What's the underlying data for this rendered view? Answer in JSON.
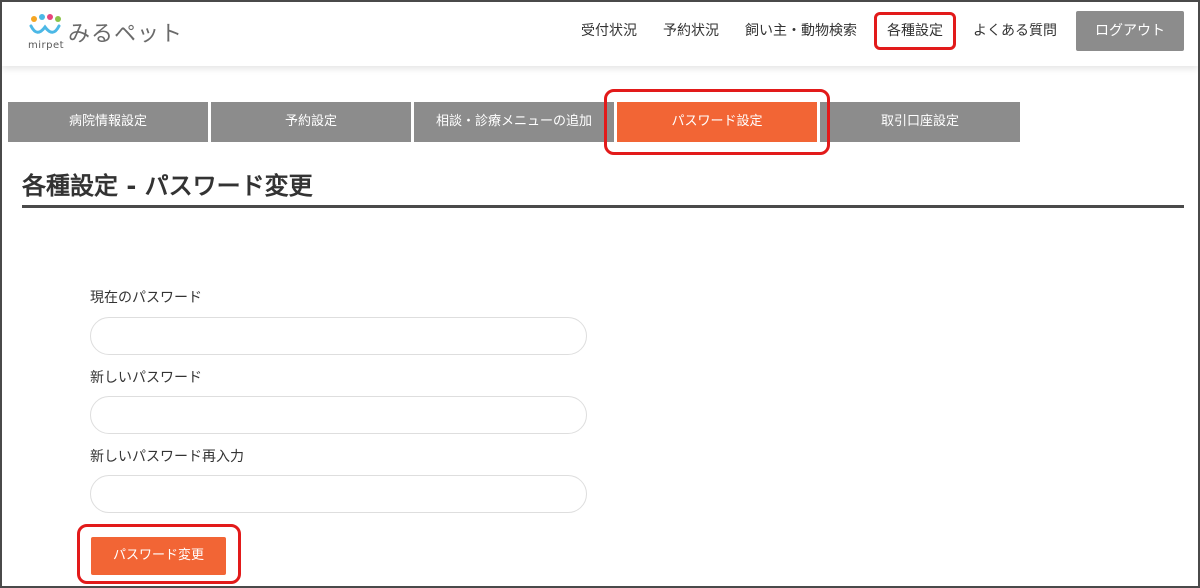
{
  "header": {
    "logo_text": "みるペット",
    "logo_sub": "mirpet",
    "nav": [
      {
        "label": "受付状況"
      },
      {
        "label": "予約状況"
      },
      {
        "label": "飼い主・動物検索"
      },
      {
        "label": "各種設定"
      },
      {
        "label": "よくある質問"
      }
    ],
    "logout_label": "ログアウト"
  },
  "tabs": [
    {
      "label": "病院情報設定"
    },
    {
      "label": "予約設定"
    },
    {
      "label": "相談・診療メニューの追加"
    },
    {
      "label": "パスワード設定"
    },
    {
      "label": "取引口座設定"
    }
  ],
  "page_title": "各種設定 - パスワード変更",
  "form": {
    "current_label": "現在のパスワード",
    "current_value": "",
    "new_label": "新しいパスワード",
    "new_value": "",
    "confirm_label": "新しいパスワード再入力",
    "confirm_value": "",
    "submit_label": "パスワード変更"
  },
  "colors": {
    "accent": "#f26535",
    "tab_gray": "#8c8c8c",
    "highlight_red": "#e21a1a"
  }
}
